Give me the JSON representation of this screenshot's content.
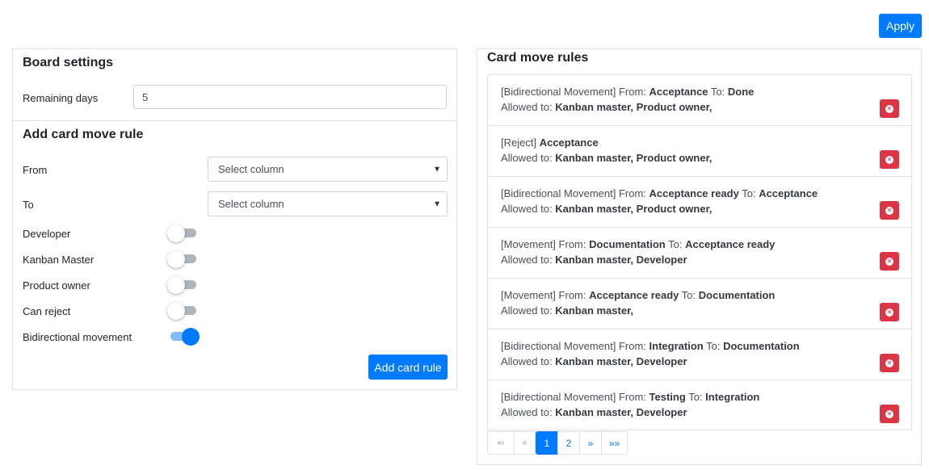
{
  "header": {
    "apply_label": "Apply"
  },
  "board_settings": {
    "title": "Board settings",
    "remaining_days_label": "Remaining days",
    "remaining_days_value": "5"
  },
  "add_rule": {
    "title": "Add card move rule",
    "from_label": "From",
    "from_value": "Select column",
    "to_label": "To",
    "to_value": "Select column",
    "toggles": [
      {
        "label": "Developer",
        "on": false
      },
      {
        "label": "Kanban Master",
        "on": false
      },
      {
        "label": "Product owner",
        "on": false
      },
      {
        "label": "Can reject",
        "on": false
      },
      {
        "label": "Bidirectional movement",
        "on": true
      }
    ],
    "add_button_label": "Add card rule"
  },
  "rules_panel": {
    "title": "Card move rules",
    "allowed_prefix": "Allowed to:",
    "rules": [
      {
        "type": "[Bidirectional Movement]",
        "from_prefix": "From:",
        "from": "Acceptance",
        "to_prefix": "To:",
        "to": "Done",
        "allowed": "Kanban master, Product owner,"
      },
      {
        "type": "[Reject]",
        "from_prefix": "",
        "from": "Acceptance",
        "to_prefix": "",
        "to": "",
        "allowed": "Kanban master, Product owner,"
      },
      {
        "type": "[Bidirectional Movement]",
        "from_prefix": "From:",
        "from": "Acceptance ready",
        "to_prefix": "To:",
        "to": "Acceptance",
        "allowed": "Kanban master, Product owner,"
      },
      {
        "type": "[Movement]",
        "from_prefix": "From:",
        "from": "Documentation",
        "to_prefix": "To:",
        "to": "Acceptance ready",
        "allowed": "Kanban master, Developer"
      },
      {
        "type": "[Movement]",
        "from_prefix": "From:",
        "from": "Acceptance ready",
        "to_prefix": "To:",
        "to": "Documentation",
        "allowed": "Kanban master,"
      },
      {
        "type": "[Bidirectional Movement]",
        "from_prefix": "From:",
        "from": "Integration",
        "to_prefix": "To:",
        "to": "Documentation",
        "allowed": "Kanban master, Developer"
      },
      {
        "type": "[Bidirectional Movement]",
        "from_prefix": "From:",
        "from": "Testing",
        "to_prefix": "To:",
        "to": "Integration",
        "allowed": "Kanban master, Developer"
      }
    ]
  },
  "pagination": {
    "first": "«‹",
    "prev": "«",
    "pages": [
      "1",
      "2"
    ],
    "active_page": "1",
    "next": "»",
    "last": "»»"
  },
  "colors": {
    "primary": "#007bff",
    "danger": "#dc3545",
    "toggle_off": "#adb5bd",
    "toggle_on_track": "#80bdff"
  },
  "icons": {
    "delete": "x-circle-icon",
    "select_caret": "caret-down-icon"
  }
}
